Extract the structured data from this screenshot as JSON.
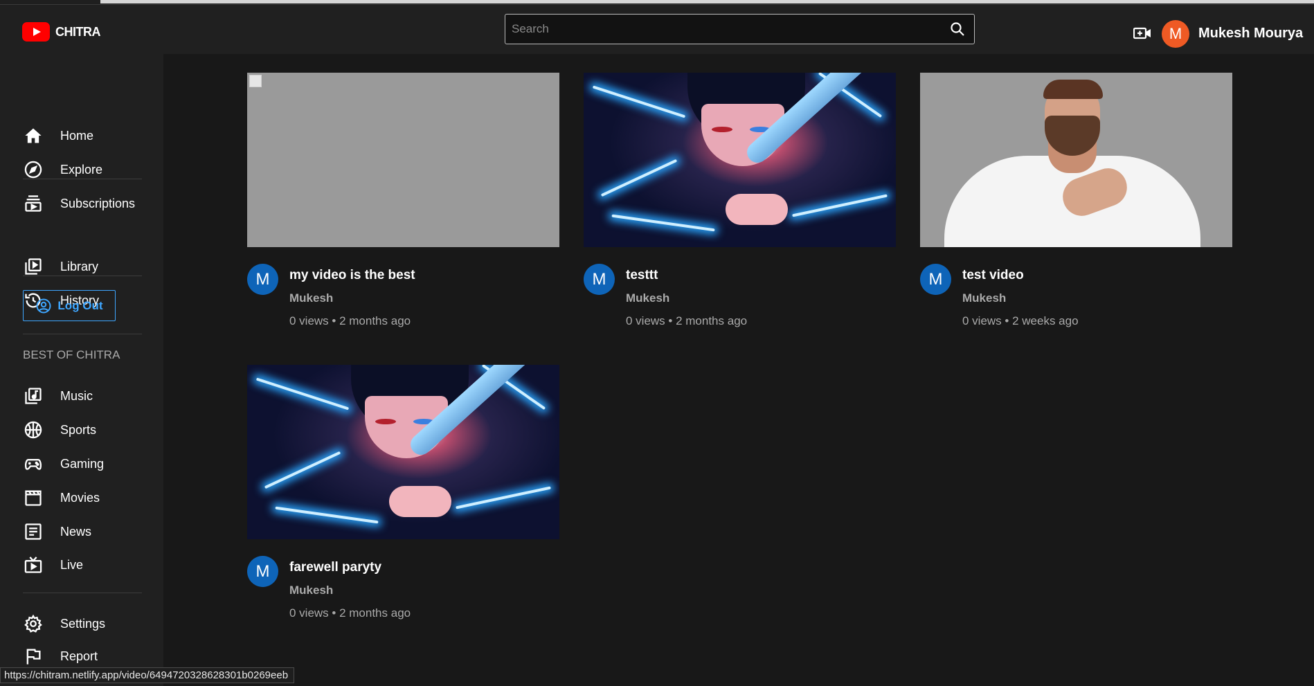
{
  "app": {
    "name": "CHITRA"
  },
  "header": {
    "search_placeholder": "Search",
    "user": {
      "initial": "M",
      "name": "Mukesh Mourya",
      "avatar_color": "#ef5a24"
    }
  },
  "sidebar": {
    "items": [
      {
        "label": "Home",
        "icon": "home-icon"
      },
      {
        "label": "Explore",
        "icon": "compass-icon"
      },
      {
        "label": "Subscriptions",
        "icon": "subscriptions-icon"
      },
      {
        "label": "Library",
        "icon": "library-icon"
      },
      {
        "label": "History",
        "icon": "history-icon"
      }
    ],
    "logout_label": "Log Out",
    "section_title": "BEST OF CHITRA",
    "best_of": [
      {
        "label": "Music",
        "icon": "music-icon"
      },
      {
        "label": "Sports",
        "icon": "sports-icon"
      },
      {
        "label": "Gaming",
        "icon": "gaming-icon"
      },
      {
        "label": "Movies",
        "icon": "movies-icon"
      },
      {
        "label": "News",
        "icon": "news-icon"
      },
      {
        "label": "Live",
        "icon": "live-icon"
      }
    ],
    "bottom": [
      {
        "label": "Settings",
        "icon": "settings-icon"
      },
      {
        "label": "Report",
        "icon": "flag-icon"
      }
    ]
  },
  "videos": [
    {
      "title": "my video is the best",
      "channel": "Mukesh",
      "stats": "0 views • 2 months ago",
      "channel_initial": "M",
      "thumbnail": "broken-image"
    },
    {
      "title": "testtt",
      "channel": "Mukesh",
      "stats": "0 views • 2 months ago",
      "channel_initial": "M",
      "thumbnail": "anime-character-lightning"
    },
    {
      "title": "test video",
      "channel": "Mukesh",
      "stats": "0 views • 2 weeks ago",
      "channel_initial": "M",
      "thumbnail": "smiling-bearded-man"
    },
    {
      "title": "farewell paryty",
      "channel": "Mukesh",
      "stats": "0 views • 2 months ago",
      "channel_initial": "M",
      "thumbnail": "anime-character-lightning"
    }
  ],
  "status_url": "https://chitram.netlify.app/video/6494720328628301b0269eeb",
  "colors": {
    "accent": "#3ea6ff",
    "brand": "#ff0000",
    "channel_avatar": "#0e64b8",
    "background": "#181818",
    "sidebar": "#202020"
  }
}
